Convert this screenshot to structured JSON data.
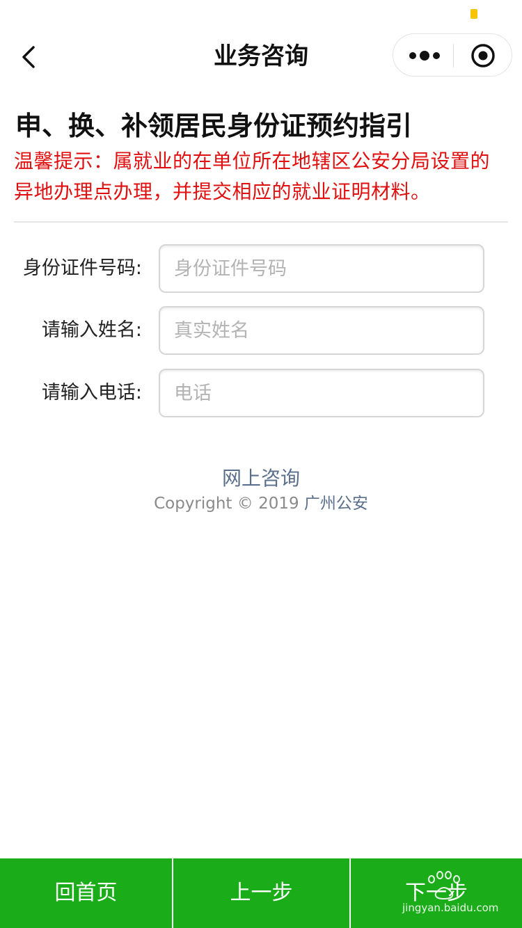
{
  "navbar": {
    "title": "业务咨询"
  },
  "content": {
    "heading": "申、换、补领居民身份证预约指引",
    "notice": " 温馨提示：属就业的在单位所在地辖区公安分局设置的异地办理点办理，并提交相应的就业证明材料。"
  },
  "form": {
    "id_label": "身份证件号码:",
    "id_placeholder": "身份证件号码",
    "name_label": "请输入姓名:",
    "name_placeholder": "真实姓名",
    "phone_label": "请输入电话:",
    "phone_placeholder": "电话"
  },
  "footer": {
    "link": "网上咨询",
    "copyright_prefix": "Copyright © 2019 ",
    "copyright_org": "广州公安"
  },
  "bottom_bar": {
    "home": "回首页",
    "prev": "上一步",
    "next": "下一步"
  },
  "watermark": {
    "text": "jingyan.baidu.com"
  },
  "colors": {
    "accent_green": "#1aad19",
    "notice_red": "#e01010",
    "link_blue_gray": "#5a6f8c"
  }
}
